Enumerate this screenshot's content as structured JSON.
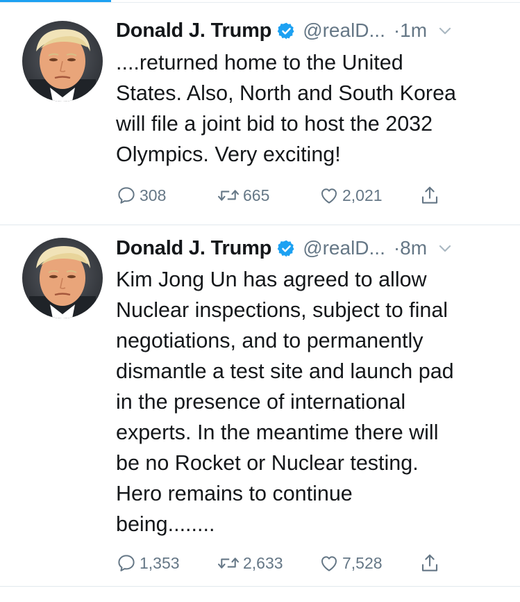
{
  "colors": {
    "accent": "#1da1f2",
    "text_primary": "#14171a",
    "text_secondary": "#657786",
    "divider": "#e1e8ed"
  },
  "tweets": [
    {
      "name": "Donald J. Trump",
      "verified_icon": "verified-badge-icon",
      "handle": "@realD...",
      "time": "·1m",
      "text": "....returned home to the United\nStates. Also, North and South Korea\nwill file a joint bid to host the 2032\nOlympics. Very exciting!",
      "replies": "308",
      "retweets": "665",
      "likes": "2,021"
    },
    {
      "name": "Donald J. Trump",
      "verified_icon": "verified-badge-icon",
      "handle": "@realD...",
      "time": "·8m",
      "text": "Kim Jong Un has agreed to allow\nNuclear inspections, subject to final\nnegotiations, and to permanently\ndismantle a test site and launch pad\nin the presence of international\nexperts. In the meantime there will\nbe no Rocket or Nuclear testing.\nHero remains to continue\nbeing........",
      "replies": "1,353",
      "retweets": "2,633",
      "likes": "7,528"
    }
  ]
}
